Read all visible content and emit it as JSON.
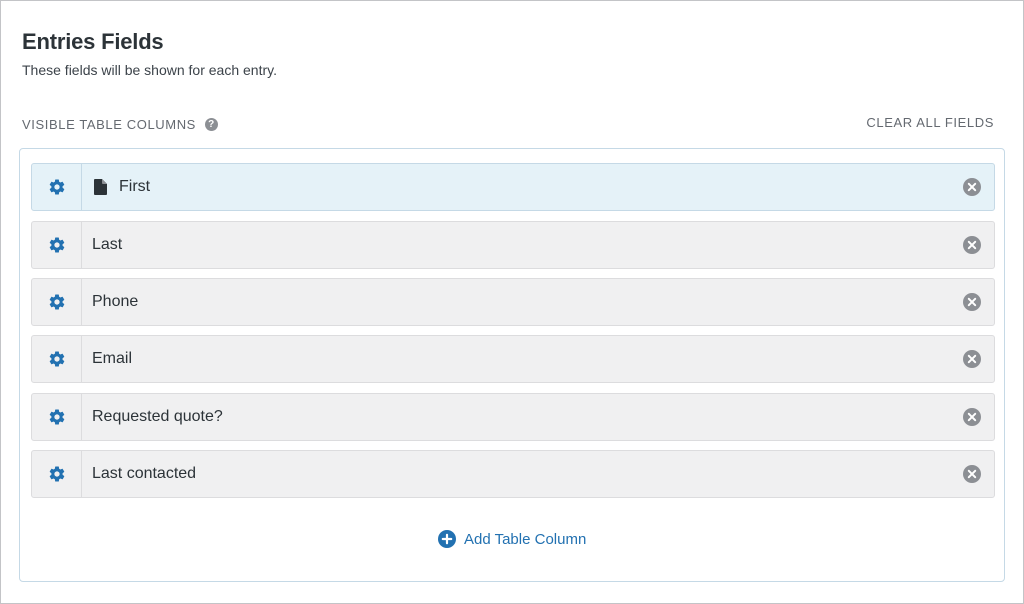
{
  "header": {
    "title": "Entries Fields",
    "subtitle": "These fields will be shown for each entry."
  },
  "section": {
    "label": "VISIBLE TABLE COLUMNS",
    "help_icon": "question-circle-icon",
    "clear_label": "CLEAR ALL FIELDS"
  },
  "fields": [
    {
      "label": "First",
      "active": true,
      "icon": "document-icon"
    },
    {
      "label": "Last"
    },
    {
      "label": "Phone"
    },
    {
      "label": "Email"
    },
    {
      "label": "Requested quote?"
    },
    {
      "label": "Last contacted"
    }
  ],
  "add_column": {
    "label": "Add Table Column",
    "icon": "plus-circle-icon"
  },
  "colors": {
    "accent": "#2271b1",
    "active_row": "#e5f2f8",
    "row": "#f0f0f1"
  }
}
